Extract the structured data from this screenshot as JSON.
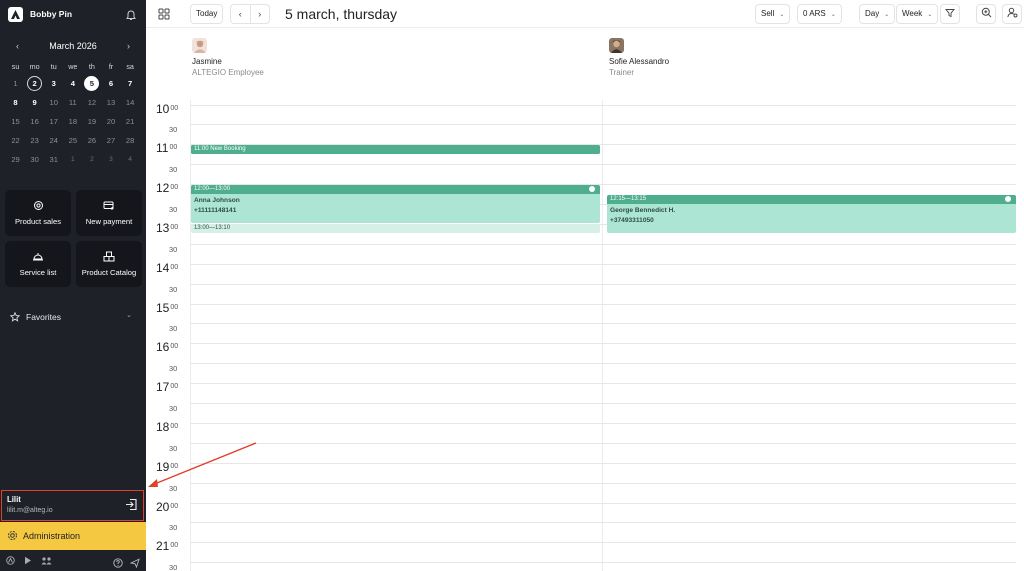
{
  "sidebar": {
    "user_name": "Bobby Pin",
    "calendar": {
      "title": "March 2026",
      "weekdays": [
        "su",
        "mo",
        "tu",
        "we",
        "th",
        "fr",
        "sa"
      ],
      "rows": [
        [
          "1",
          "2",
          "3",
          "4",
          "5",
          "6",
          "7"
        ],
        [
          "8",
          "9",
          "10",
          "11",
          "12",
          "13",
          "14"
        ],
        [
          "15",
          "16",
          "17",
          "18",
          "19",
          "20",
          "21"
        ],
        [
          "22",
          "23",
          "24",
          "25",
          "26",
          "27",
          "28"
        ],
        [
          "29",
          "30",
          "31",
          "1",
          "2",
          "3",
          "4"
        ]
      ]
    },
    "tiles": [
      {
        "label": "Product sales",
        "icon": "target-icon"
      },
      {
        "label": "New payment",
        "icon": "card-plus-icon"
      },
      {
        "label": "Service list",
        "icon": "service-icon"
      },
      {
        "label": "Product Catalog",
        "icon": "boxes-icon"
      }
    ],
    "favorites_label": "Favorites",
    "account": {
      "name": "Lilit",
      "email": "lilit.m@alteg.io"
    },
    "admin_label": "Administration"
  },
  "topbar": {
    "today_label": "Today",
    "date_title": "5 march, thursday",
    "sell_label": "Sell",
    "currency_label": "0 ARS",
    "view_day_label": "Day",
    "view_week_label": "Week"
  },
  "staff": [
    {
      "name": "Jasmine",
      "role": "ALTEGIO Employee"
    },
    {
      "name": "Sofie Alessandro",
      "role": "Trainer"
    }
  ],
  "hours": [
    "10",
    "11",
    "12",
    "13",
    "14",
    "15",
    "16",
    "17",
    "18",
    "19",
    "20",
    "21"
  ],
  "minute_labels": {
    "full": "00",
    "half": "30"
  },
  "events": [
    {
      "column": 0,
      "time": "11:00 New Booking",
      "client": "",
      "phone": "",
      "start": "11:00",
      "end": "11:15"
    },
    {
      "column": 0,
      "time": "12:00—13:00",
      "client": "Anna Johnson",
      "phone": "+11111148141",
      "start": "12:00",
      "end": "13:00"
    },
    {
      "column": 0,
      "time": "13:00—13:10",
      "client": "",
      "phone": "",
      "start": "13:00",
      "end": "13:10"
    },
    {
      "column": 1,
      "time": "12:15—13:15",
      "client": "George Bennedict H.",
      "phone": "+37493311050",
      "start": "12:15",
      "end": "13:15"
    }
  ],
  "colors": {
    "sidebar": "#1f2128",
    "event_bar": "#4fae8e",
    "event_body": "#ade5d5",
    "admin": "#f5c842",
    "highlight": "#e0412b"
  }
}
